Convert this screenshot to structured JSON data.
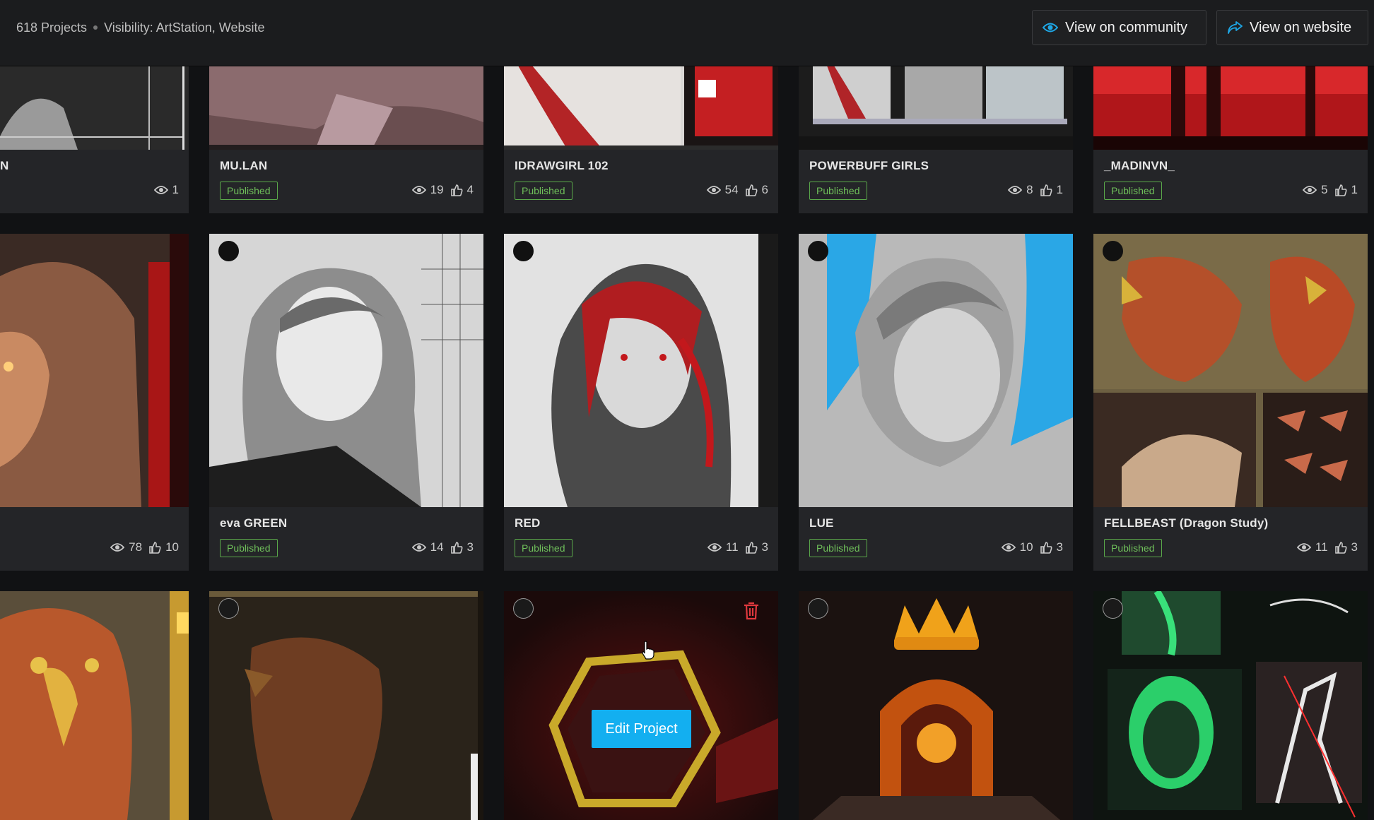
{
  "header": {
    "project_count": "618 Projects",
    "visibility": "Visibility: ArtStation, Website",
    "view_community": "View on community",
    "view_website": "View on website"
  },
  "rows": [
    [
      {
        "title": "N",
        "status": "",
        "views": "1",
        "likes": ""
      },
      {
        "title": "MU.LAN",
        "status": "Published",
        "views": "19",
        "likes": "4"
      },
      {
        "title": "IDRAWGIRL 102",
        "status": "Published",
        "views": "54",
        "likes": "6"
      },
      {
        "title": "POWERBUFF GIRLS",
        "status": "Published",
        "views": "8",
        "likes": "1"
      },
      {
        "title": "_MADINVN_",
        "status": "Published",
        "views": "5",
        "likes": "1"
      }
    ],
    [
      {
        "title": "",
        "status": "",
        "views": "78",
        "likes": "10"
      },
      {
        "title": "eva GREEN",
        "status": "Published",
        "views": "14",
        "likes": "3"
      },
      {
        "title": "RED",
        "status": "Published",
        "views": "11",
        "likes": "3"
      },
      {
        "title": "LUE",
        "status": "Published",
        "views": "10",
        "likes": "3"
      },
      {
        "title": "FELLBEAST (Dragon Study)",
        "status": "Published",
        "views": "11",
        "likes": "3"
      }
    ]
  ],
  "edit_label": "Edit Project",
  "colors": {
    "accent": "#13aff0",
    "published": "#6fbf5a",
    "delete": "#e0393e"
  }
}
